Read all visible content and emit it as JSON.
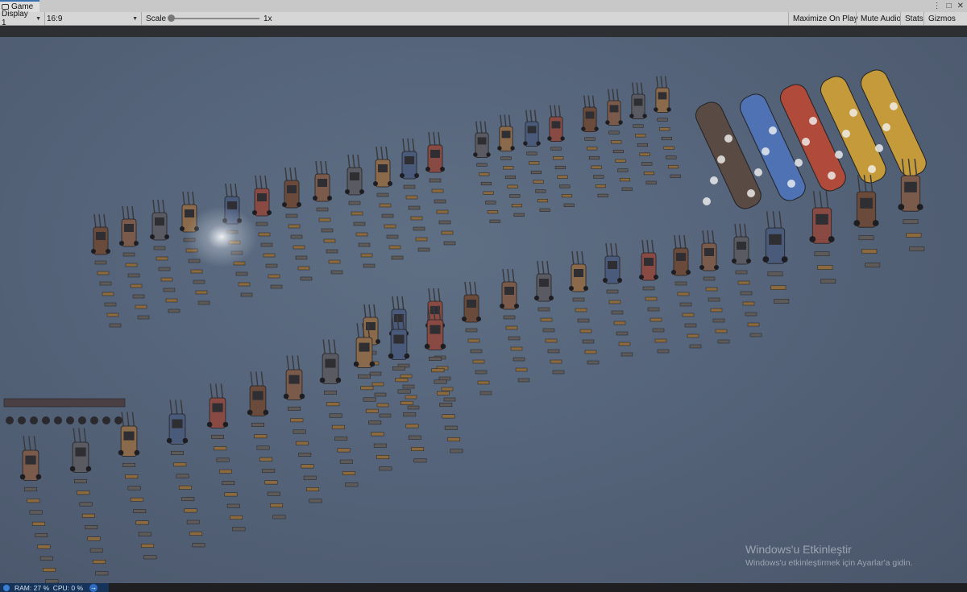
{
  "window": {
    "tab_title": "Game",
    "controls": [
      "⋮",
      "□",
      "✕"
    ]
  },
  "toolbar": {
    "display_select": "Display 1",
    "aspect_select": "16:9",
    "scale_label": "Scale",
    "scale_value": "1x",
    "maximize_on_play": "Maximize On Play",
    "mute_audio": "Mute Audio",
    "stats": "Stats",
    "gizmos": "Gizmos"
  },
  "viewport": {
    "watermark_title": "Windows'u Etkinleştir",
    "watermark_subtitle": "Windows'u etkinleştirmek için Ayarlar'a gidin.",
    "tank_colors": [
      "#4e72b4",
      "#b04a3a",
      "#c49a3a"
    ],
    "vehicle_colors": [
      "#6a4a3a",
      "#7a5a4a",
      "#5a5a62",
      "#8a6a4a",
      "#4a5a7a",
      "#8a4a44"
    ]
  },
  "status": {
    "ram_label": "RAM:",
    "ram_value": "27 %",
    "cpu_label": "CPU:",
    "cpu_value": "0 %"
  }
}
